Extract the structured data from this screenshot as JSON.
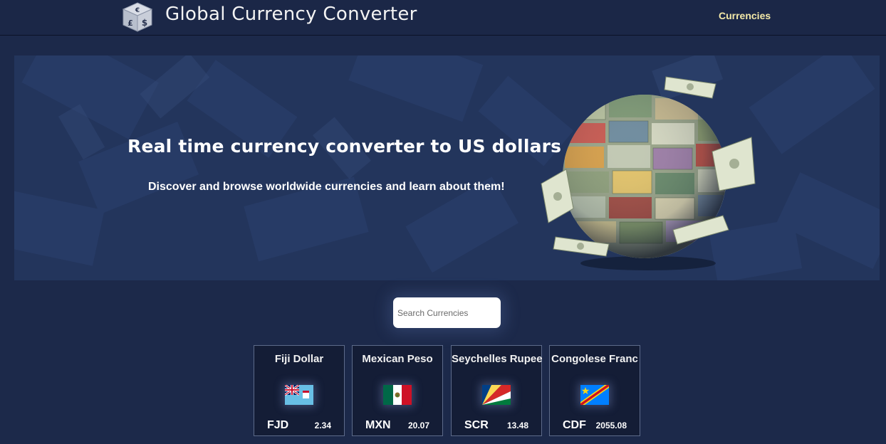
{
  "header": {
    "title": "Global Currency Converter",
    "nav_currencies": "Currencies",
    "logo_icon": "currency-dice-icon"
  },
  "hero": {
    "title": "Real time currency converter to US dollars",
    "subtitle": "Discover and browse worldwide currencies and learn about them!",
    "art_icon": "money-globe-illustration"
  },
  "search": {
    "placeholder": "Search Currencies",
    "value": ""
  },
  "currencies": [
    {
      "name": "Fiji Dollar",
      "code": "FJD",
      "rate": "2.34",
      "flag": "fiji-flag-icon"
    },
    {
      "name": "Mexican Peso",
      "code": "MXN",
      "rate": "20.07",
      "flag": "mexico-flag-icon"
    },
    {
      "name": "Seychelles Rupee",
      "code": "SCR",
      "rate": "13.48",
      "flag": "seychelles-flag-icon"
    },
    {
      "name": "Congolese Franc",
      "code": "CDF",
      "rate": "2055.08",
      "flag": "dr-congo-flag-icon"
    }
  ],
  "colors": {
    "background": "#1c294a",
    "hero": "#23355c",
    "accent_nav": "#f4e9a8",
    "card": "#141d36"
  }
}
